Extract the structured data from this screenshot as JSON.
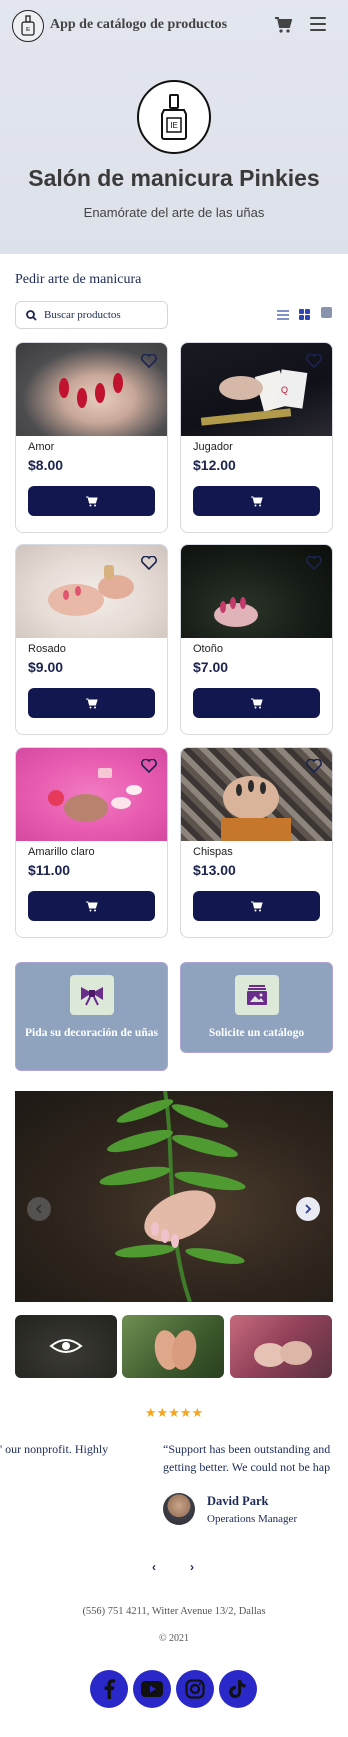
{
  "header": {
    "app_title": "App de catálogo de productos"
  },
  "hero": {
    "title": "Salón de manicura Pinkies",
    "subtitle": "Enamórate del arte de las uñas"
  },
  "catalog": {
    "section_title": "Pedir arte de manicura",
    "search_placeholder": "Buscar productos",
    "products": [
      {
        "name": "Amor",
        "price": "$8.00"
      },
      {
        "name": "Jugador",
        "price": "$12.00"
      },
      {
        "name": "Rosado",
        "price": "$9.00"
      },
      {
        "name": "Otoño",
        "price": "$7.00"
      },
      {
        "name": "Amarillo claro",
        "price": "$11.00"
      },
      {
        "name": "Chispas",
        "price": "$13.00"
      }
    ]
  },
  "actions": {
    "order_decoration": "Pida su decoración de uñas",
    "request_catalog": "Solicite un catálogo"
  },
  "testimonials": {
    "stars": "★★★★★",
    "quote_prev": "' our nonprofit. Highly",
    "quote_main_line1": "“Support has been outstanding and",
    "quote_main_line2": "getting better. We could not be hap",
    "person_name": "David Park",
    "person_role": "Operations Manager",
    "prev": "‹",
    "next": "›"
  },
  "footer": {
    "address": "(556) 751 4211, Witter Avenue 13/2, Dallas",
    "copyright": "© 2021",
    "social": [
      "facebook-icon",
      "youtube-icon",
      "instagram-icon",
      "tiktok-icon"
    ]
  },
  "colors": {
    "accent": "#12184f",
    "social": "#2a28c9",
    "tile": "#8fa3bf",
    "star": "#f5a623"
  }
}
